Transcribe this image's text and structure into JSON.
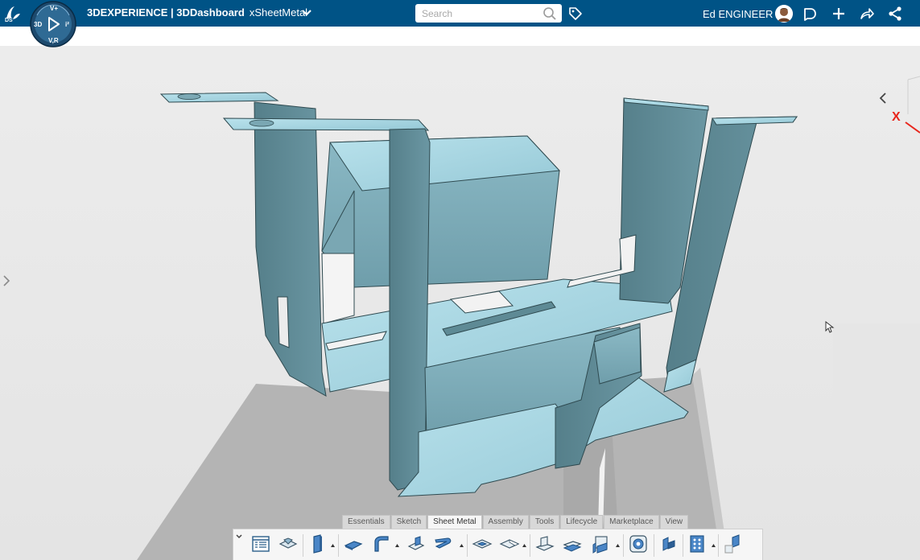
{
  "topbar": {
    "brand": "3DEXPERIENCE | 3DDashboard",
    "app_name": "xSheetMetal",
    "search_placeholder": "Search",
    "user_name": "Ed ENGINEER"
  },
  "compass": {
    "top_label": "V+",
    "left_label": "3D",
    "right_label": "i²",
    "bottom_label": "V,R"
  },
  "viewport": {
    "axis_x_label": "X"
  },
  "action_bar": {
    "tabs": [
      {
        "label": "Essentials",
        "active": false
      },
      {
        "label": "Sketch",
        "active": false
      },
      {
        "label": "Sheet Metal",
        "active": true
      },
      {
        "label": "Assembly",
        "active": false
      },
      {
        "label": "Tools",
        "active": false
      },
      {
        "label": "Lifecycle",
        "active": false
      },
      {
        "label": "Marketplace",
        "active": false
      },
      {
        "label": "View",
        "active": false
      }
    ],
    "tools": [
      "feature-tree-icon",
      "sheet-metal-parameters-icon",
      "wall-icon",
      "flange-icon",
      "bend-icon",
      "corner-relief-icon",
      "hem-icon",
      "stamp-icon",
      "cutout-icon",
      "unfold-icon",
      "fold-icon",
      "flat-view-icon",
      "recognize-icon",
      "pattern-icon",
      "add-part-icon"
    ]
  },
  "colors": {
    "topbar": "#005386",
    "part_face": "#a6d6e2",
    "part_dark": "#5b8792",
    "ground_shadow": "#b4b4b4"
  }
}
